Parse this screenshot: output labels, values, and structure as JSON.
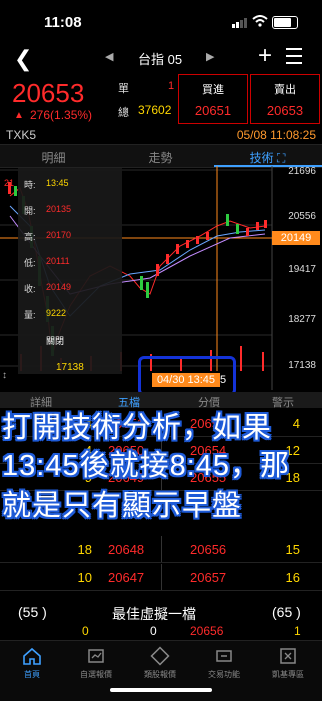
{
  "status": {
    "time": "11:08"
  },
  "nav": {
    "title": "台指 05"
  },
  "quote": {
    "price": "20653",
    "change": "276(1.35%)",
    "single_label": "單",
    "single_value": "1",
    "total_label": "總",
    "total_value": "37602",
    "bid_label": "買進",
    "bid_value": "20651",
    "ask_label": "賣出",
    "ask_value": "20653",
    "symbol": "TXK5",
    "datetime": "05/08 11:08:25"
  },
  "tabs": [
    "明細",
    "走勢",
    "技術 ⛶"
  ],
  "chart": {
    "tooltip": [
      {
        "k": "時:",
        "v": "13:45",
        "color": "#ffd700"
      },
      {
        "k": "開:",
        "v": "20135",
        "color": "#ff2b2b"
      },
      {
        "k": "高:",
        "v": "20170",
        "color": "#ff2b2b"
      },
      {
        "k": "低:",
        "v": "20111",
        "color": "#ff2b2b"
      },
      {
        "k": "收:",
        "v": "20149",
        "color": "#ff2b2b"
      },
      {
        "k": "量:",
        "v": "9222",
        "color": "#ffd700"
      },
      {
        "k": "",
        "v": "關閉",
        "color": "#ffffff"
      }
    ],
    "left_partial": "21",
    "low_marker": "17138",
    "date_tag": "04/30 13:45",
    "date_tag_suffix": "5",
    "current_price": "20149",
    "y_labels": [
      "21696",
      "20556",
      "19417",
      "18277",
      "17138"
    ]
  },
  "orderbook": {
    "headers": [
      "詳細",
      "五檔",
      "分價",
      "警示"
    ],
    "rows": [
      {
        "a": "4",
        "b": "20651",
        "c": "20653",
        "d": "4"
      },
      {
        "a": "4",
        "b": "20650",
        "c": "20654",
        "d": "12"
      },
      {
        "a": "9",
        "b": "20649",
        "c": "20655",
        "d": "18"
      },
      {
        "a": "18",
        "b": "20648",
        "c": "20656",
        "d": "15"
      },
      {
        "a": "10",
        "b": "20647",
        "c": "20657",
        "d": "16"
      }
    ]
  },
  "overlay": {
    "line1": "打開技術分析，如果",
    "line2": "13:45後就接8:45，那",
    "line3": "就是只有顯示早盤"
  },
  "virtual": {
    "left": "(55 )",
    "title": "最佳虛擬一檔",
    "right": "(65 )",
    "v1": "0",
    "v2": "0",
    "v3": "20656",
    "v4": "1"
  },
  "bottom_nav": [
    {
      "label": "首頁",
      "icon": "home-icon"
    },
    {
      "label": "自選報價",
      "icon": "quote-icon"
    },
    {
      "label": "類股報價",
      "icon": "category-icon"
    },
    {
      "label": "交易功能",
      "icon": "trade-icon"
    },
    {
      "label": "凱基專區",
      "icon": "zone-icon"
    }
  ],
  "colors": {
    "up": "#ff2b2b",
    "accent": "#3ea0ff",
    "orange": "#ff8a1c",
    "overlay_stroke": "#1e5bd8"
  }
}
